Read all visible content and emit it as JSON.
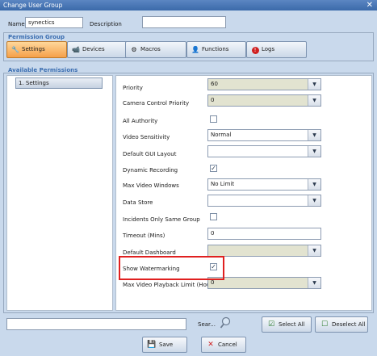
{
  "window": {
    "title": "Change User Group",
    "close_symbol": "✕"
  },
  "header": {
    "name_label": "Name",
    "name_value": "synectics",
    "description_label": "Description",
    "description_value": ""
  },
  "permission_group": {
    "title": "Permission Group",
    "tabs": [
      {
        "label": "Settings",
        "icon": "wrench-icon",
        "active": true
      },
      {
        "label": "Devices",
        "icon": "camera-icon",
        "active": false
      },
      {
        "label": "Macros",
        "icon": "gears-icon",
        "active": false
      },
      {
        "label": "Functions",
        "icon": "user-key-icon",
        "active": false
      },
      {
        "label": "Logs",
        "icon": "stop-icon",
        "active": false
      }
    ]
  },
  "available_permissions": {
    "title": "Available Permissions",
    "items": [
      {
        "label": "1. Settings"
      }
    ]
  },
  "settings": [
    {
      "label": "Priority",
      "type": "dropdown",
      "value": "60",
      "disabled": true
    },
    {
      "label": "Camera Control Priority",
      "type": "dropdown",
      "value": "0",
      "disabled": true
    },
    {
      "label": "All Authority",
      "type": "checkbox",
      "checked": false
    },
    {
      "label": "Video Sensitivity",
      "type": "dropdown",
      "value": "Normal",
      "disabled": false
    },
    {
      "label": "Default GUI Layout",
      "type": "dropdown",
      "value": "",
      "disabled": false
    },
    {
      "label": "Dynamic Recording",
      "type": "checkbox",
      "checked": true
    },
    {
      "label": "Max Video Windows",
      "type": "dropdown",
      "value": "No Limit",
      "disabled": false
    },
    {
      "label": "Data Store",
      "type": "dropdown",
      "value": "",
      "disabled": false
    },
    {
      "label": "Incidents Only Same Group",
      "type": "checkbox",
      "checked": false
    },
    {
      "label": "Timeout (Mins)",
      "type": "text",
      "value": "0"
    },
    {
      "label": "Default Dashboard",
      "type": "dropdown",
      "value": "",
      "disabled": true
    },
    {
      "label": "Show Watermarking",
      "type": "checkbox",
      "checked": true,
      "highlighted": true
    },
    {
      "label": "Max Video Playback Limit (Hours)",
      "type": "dropdown",
      "value": "0",
      "disabled": true
    }
  ],
  "search": {
    "value": "",
    "label": "Sear..."
  },
  "actions": {
    "select_all": "Select All",
    "deselect_all": "Deselect All",
    "save": "Save",
    "cancel": "Cancel"
  },
  "colors": {
    "highlight_border": "#e02020",
    "active_tab": "#f5a04a",
    "title_bar": "#3b6aaa"
  }
}
